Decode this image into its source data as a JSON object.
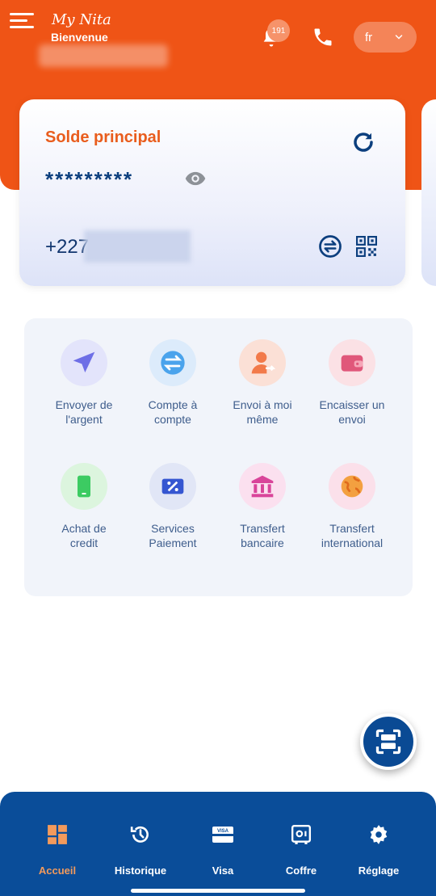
{
  "header": {
    "brand": "My Nita",
    "welcome": "Bienvenue",
    "notification_count": "191",
    "language": "fr"
  },
  "balance_card": {
    "title": "Solde principal",
    "masked_balance": "*********",
    "phone_prefix": "+227"
  },
  "services": [
    {
      "label_line1": "Envoyer de",
      "label_line2": "l'argent",
      "icon": "send-icon"
    },
    {
      "label_line1": "Compte à",
      "label_line2": "compte",
      "icon": "transfer-arrows-icon"
    },
    {
      "label_line1": "Envoi à moi",
      "label_line2": "même",
      "icon": "person-arrow-icon"
    },
    {
      "label_line1": "Encaisser un",
      "label_line2": "envoi",
      "icon": "wallet-icon"
    },
    {
      "label_line1": "Achat de",
      "label_line2": "credit",
      "icon": "phone-device-icon"
    },
    {
      "label_line1": "Services",
      "label_line2": "Paiement",
      "icon": "coupon-percent-icon"
    },
    {
      "label_line1": "Transfert",
      "label_line2": "bancaire",
      "icon": "bank-icon"
    },
    {
      "label_line1": "Transfert",
      "label_line2": "international",
      "icon": "globe-icon"
    }
  ],
  "bottom_nav": [
    {
      "label": "Accueil",
      "icon": "dashboard-icon",
      "active": true
    },
    {
      "label": "Historique",
      "icon": "history-icon",
      "active": false
    },
    {
      "label": "Visa",
      "icon": "visa-card-icon",
      "active": false
    },
    {
      "label": "Coffre",
      "icon": "safe-icon",
      "active": false
    },
    {
      "label": "Réglage",
      "icon": "gear-icon",
      "active": false
    }
  ],
  "colors": {
    "brand_orange": "#ef5416",
    "brand_blue": "#0a4d99",
    "active_nav": "#f29a5c"
  }
}
